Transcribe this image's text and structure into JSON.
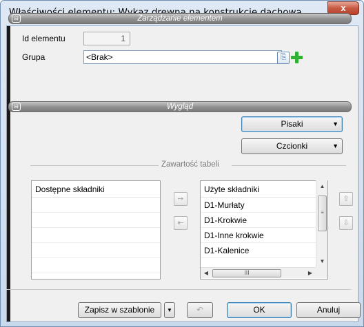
{
  "window": {
    "title": "Właściwości elementu: Wykaz drewna na konstrukcję dachową",
    "close_glyph": "x"
  },
  "section_management": {
    "label": "Zarządzanie elementem",
    "id_label": "Id elementu",
    "id_value": "1",
    "group_label": "Grupa",
    "group_value": "<Brak>"
  },
  "section_appearance": {
    "label": "Wygląd",
    "pens_button": "Pisaki",
    "fonts_button": "Czcionki"
  },
  "table_contents": {
    "caption": "Zawartość tabeli",
    "available": {
      "header": "Dostępne składniki",
      "items": []
    },
    "used": {
      "header": "Użyte składniki",
      "items": [
        "D1-Murłaty",
        "D1-Krokwie",
        "D1-Inne krokwie",
        "D1-Kalenice"
      ]
    }
  },
  "icons": {
    "collapse": "⊟",
    "move_right": "➙",
    "move_left": "⇤",
    "move_up": "⇧",
    "move_down": "⇩",
    "dropdown": "▼",
    "scroll_up": "▲",
    "scroll_down": "▼",
    "scroll_left": "◀",
    "scroll_right": "▶",
    "grip_vertical": "≡",
    "grip_horizontal": "III",
    "undo": "↶",
    "browse": "⎘"
  },
  "footer": {
    "save_template": "Zapisz w szablonie",
    "ok": "OK",
    "cancel": "Anuluj"
  }
}
